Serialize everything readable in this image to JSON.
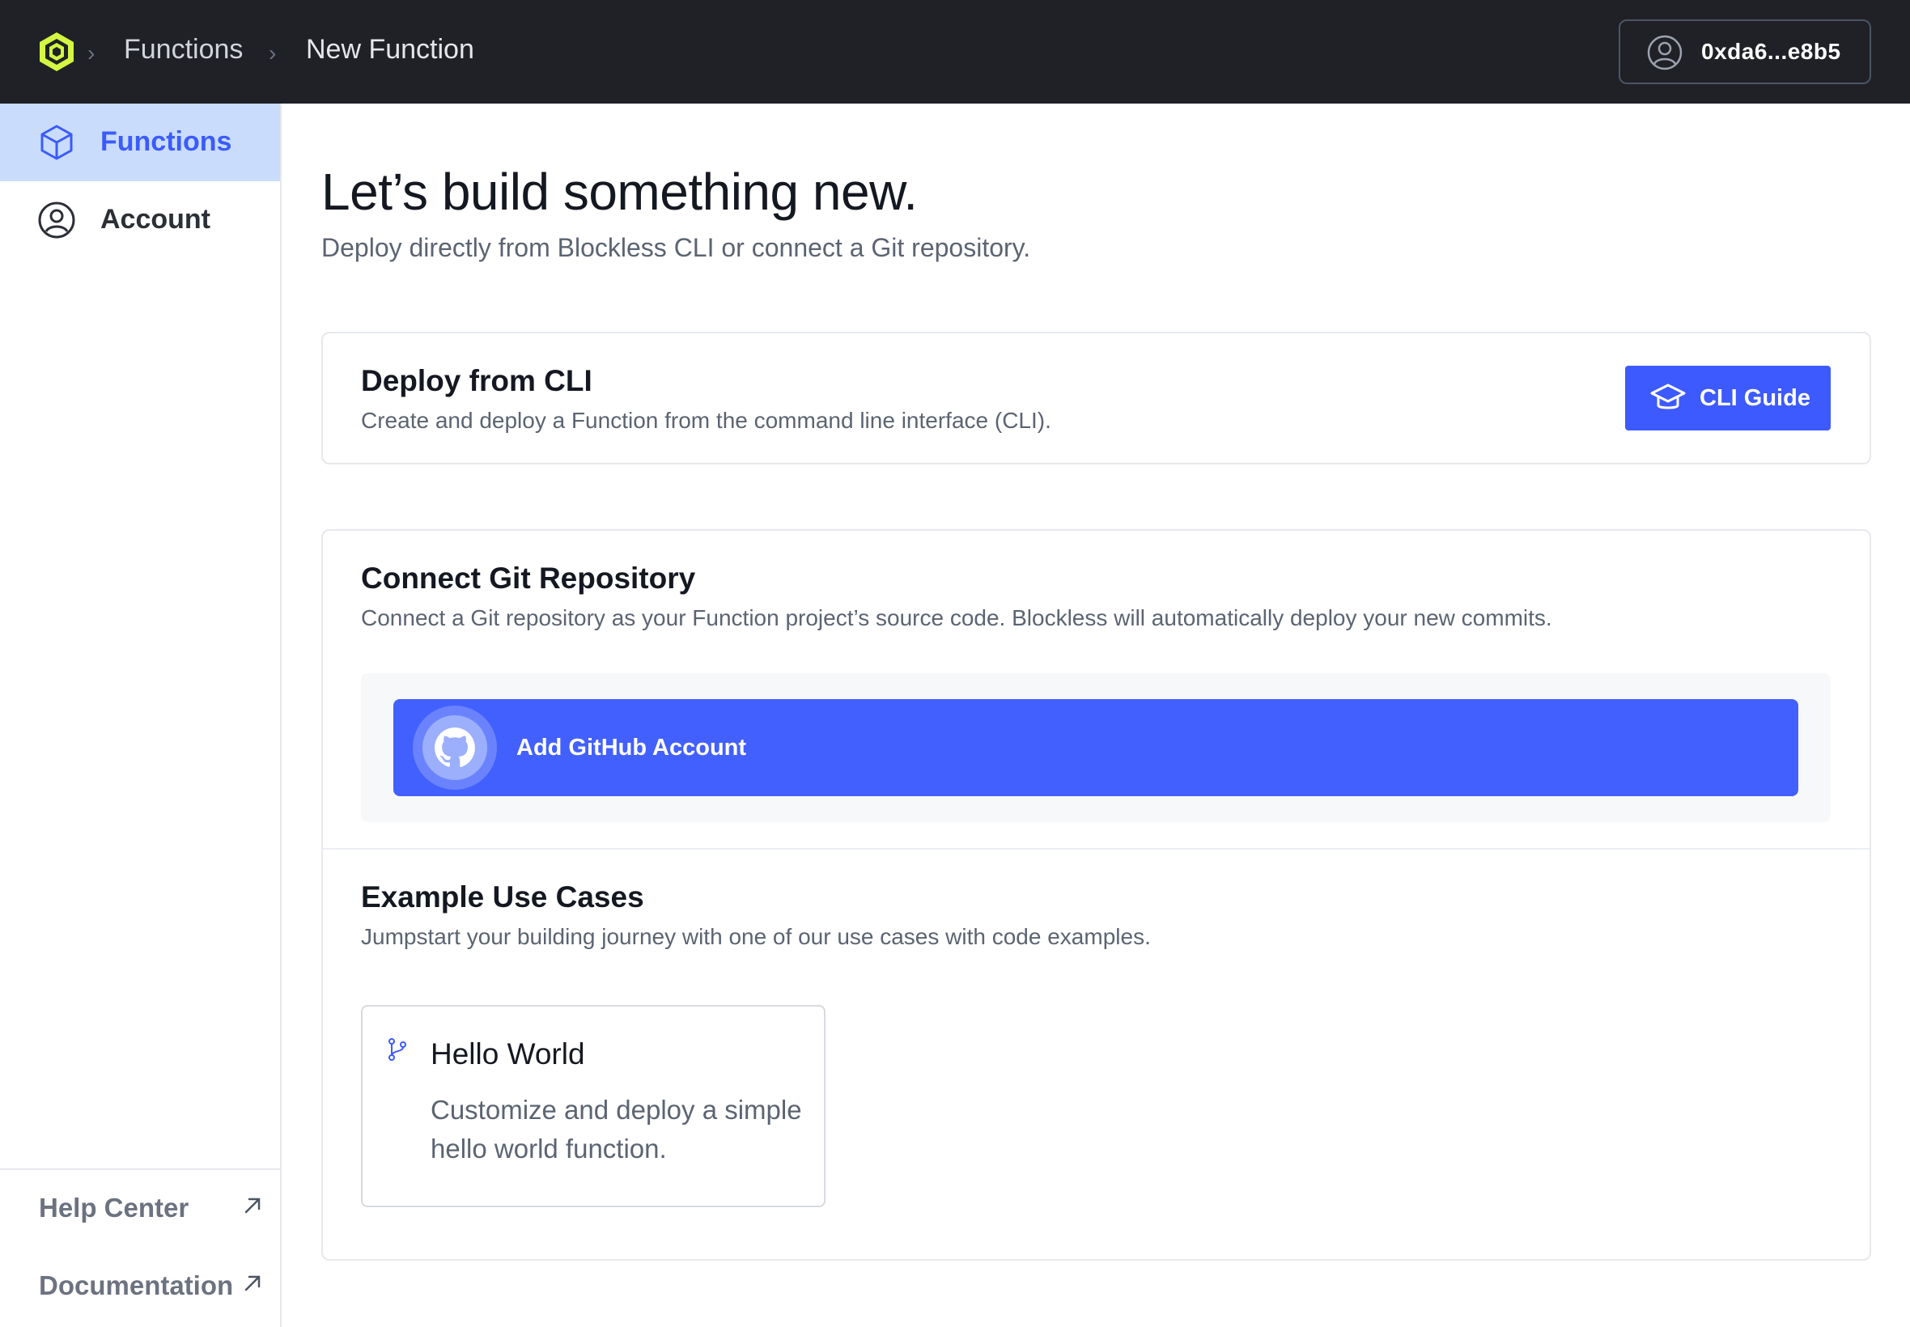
{
  "header": {
    "breadcrumb": [
      "Functions",
      "New Function"
    ],
    "account_address": "0xda6...e8b5"
  },
  "sidebar": {
    "items": [
      {
        "label": "Functions",
        "icon": "cube-icon",
        "active": true
      },
      {
        "label": "Account",
        "icon": "user-circle-icon",
        "active": false
      }
    ],
    "footer": [
      {
        "label": "Help Center",
        "icon": "external-link-icon"
      },
      {
        "label": "Documentation",
        "icon": "external-link-icon"
      }
    ]
  },
  "main": {
    "title": "Let’s build something new.",
    "subtitle": "Deploy directly from Blockless CLI or connect a Git repository.",
    "cli_card": {
      "title": "Deploy from CLI",
      "description": "Create and deploy a Function from the command line interface (CLI).",
      "button_label": "CLI Guide",
      "button_icon": "graduation-cap-icon"
    },
    "git_card": {
      "title": "Connect Git Repository",
      "description": "Connect a Git repository as your Function project’s source code. Blockless will automatically deploy your new commits.",
      "github_button_label": "Add GitHub Account",
      "github_icon": "github-icon"
    },
    "examples": {
      "title": "Example Use Cases",
      "description": "Jumpstart your building journey with one of our use cases with code examples.",
      "items": [
        {
          "title": "Hello World",
          "description": "Customize and deploy a simple hello world function.",
          "icon": "git-branch-icon"
        }
      ]
    }
  },
  "colors": {
    "topbar": "#1f2126",
    "accent": "#3d5afe",
    "logo": "#d4f542",
    "active_nav_bg": "#c9dcfb"
  }
}
